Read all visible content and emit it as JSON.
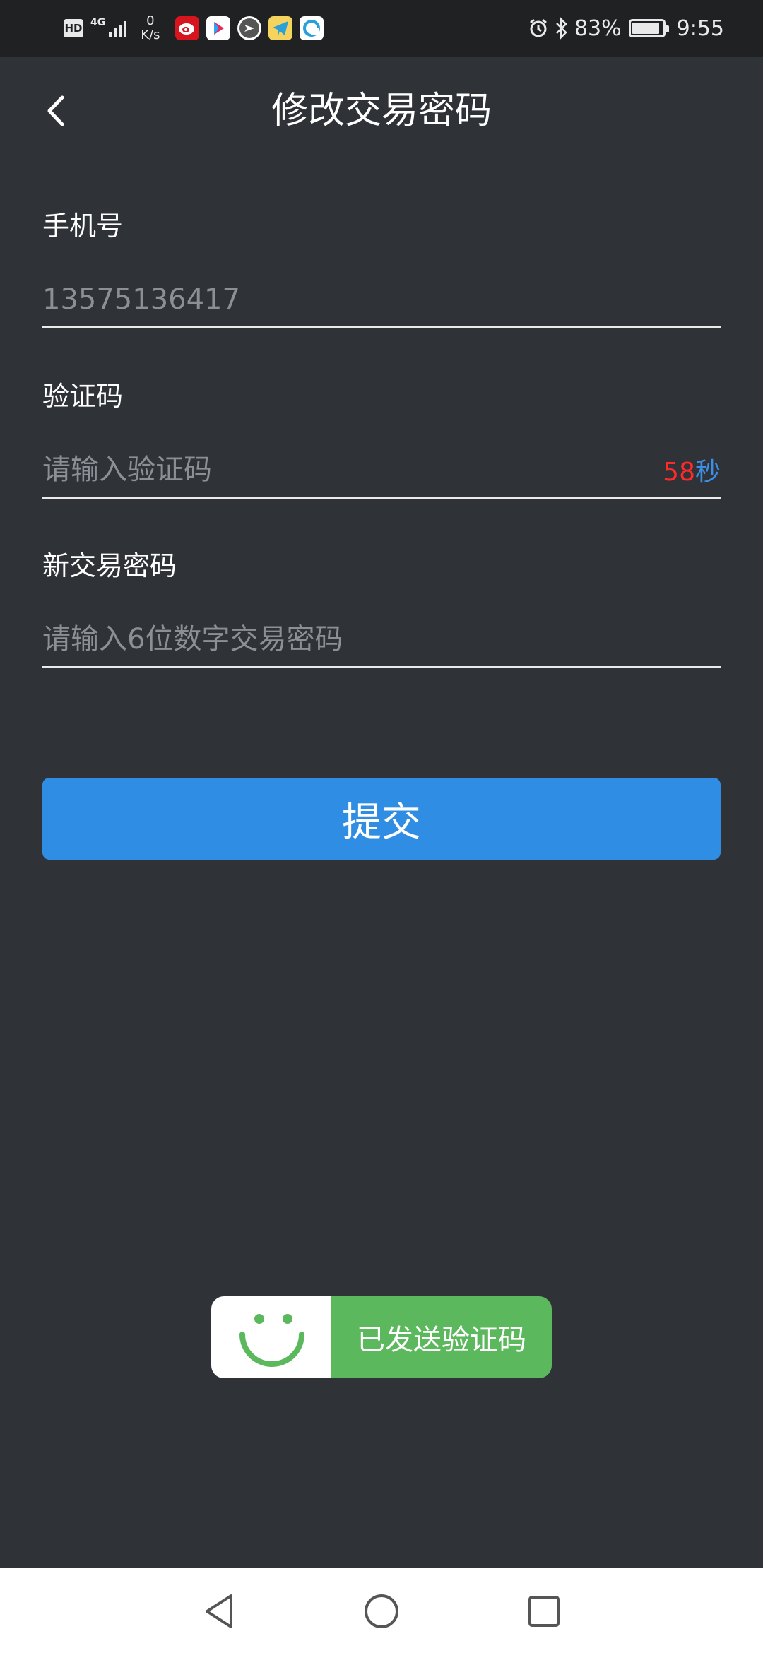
{
  "status_bar": {
    "hd": "HD",
    "network": "4G",
    "net_speed_value": "0",
    "net_speed_unit": "K/s",
    "battery_percent": "83%",
    "battery_level": 0.83,
    "time": "9:55",
    "icons": [
      "weibo-icon",
      "youku-icon",
      "app-icon",
      "telegram-icon",
      "browser-icon",
      "alarm-icon",
      "bluetooth-icon",
      "battery-icon"
    ]
  },
  "header": {
    "title": "修改交易密码"
  },
  "form": {
    "phone": {
      "label": "手机号",
      "value": "13575136417"
    },
    "code": {
      "label": "验证码",
      "placeholder": "请输入验证码",
      "countdown_value": "58",
      "countdown_unit": "秒"
    },
    "new_password": {
      "label": "新交易密码",
      "placeholder": "请输入6位数字交易密码"
    },
    "submit_label": "提交"
  },
  "toast": {
    "message": "已发送验证码"
  },
  "colors": {
    "background": "#2f3236",
    "accent": "#2f8de3",
    "countdown_number": "#ff2a2a",
    "toast_green": "#5cb85c"
  }
}
